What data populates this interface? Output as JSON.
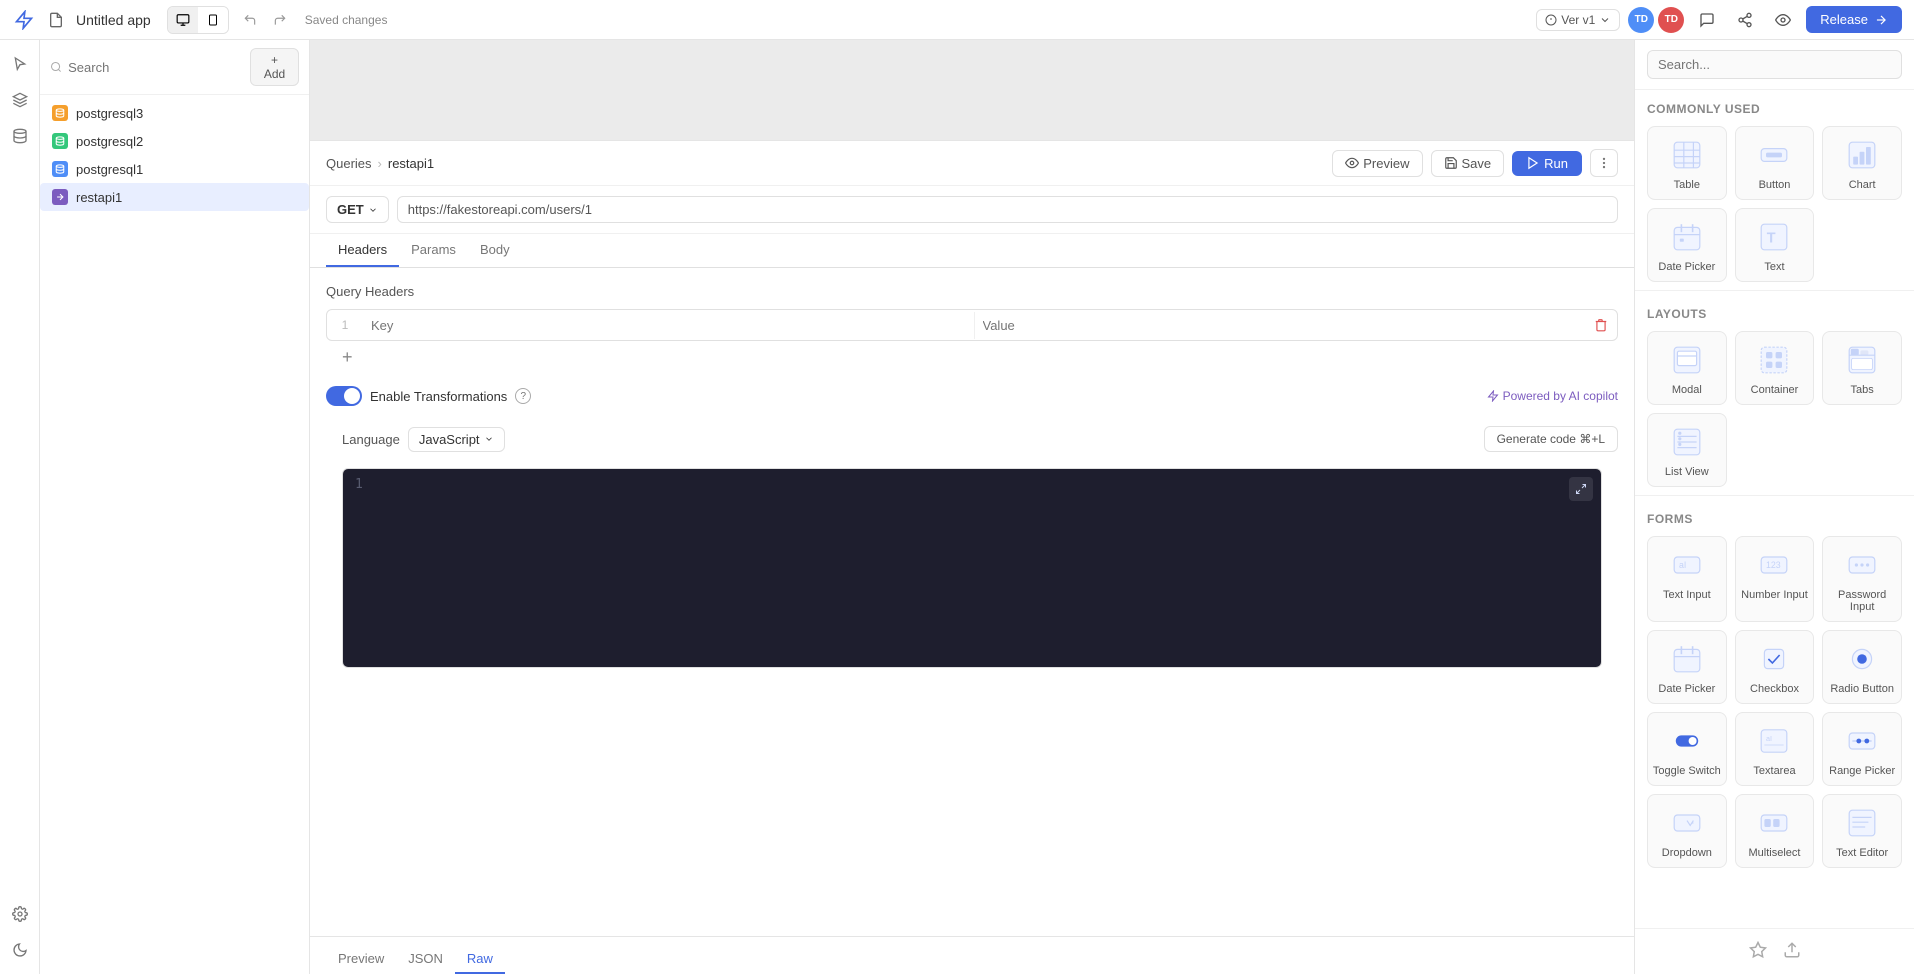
{
  "topbar": {
    "title": "Untitled app",
    "saved_label": "Saved changes",
    "version_label": "Ver  v1",
    "avatar1": "TD",
    "avatar2": "TD",
    "release_label": "Release"
  },
  "left_panel": {
    "search_placeholder": "Search",
    "add_label": "+ Add",
    "items": [
      {
        "id": "postgresql3",
        "label": "postgresql3",
        "type": "db"
      },
      {
        "id": "postgresql2",
        "label": "postgresql2",
        "type": "db"
      },
      {
        "id": "postgresql1",
        "label": "postgresql1",
        "type": "db"
      },
      {
        "id": "restapi1",
        "label": "restapi1",
        "type": "restapi",
        "active": true
      }
    ]
  },
  "query_editor": {
    "breadcrumb_root": "Queries",
    "breadcrumb_current": "restapi1",
    "preview_label": "Preview",
    "save_label": "Save",
    "run_label": "Run",
    "method": "GET",
    "url": "https://fakestoreapi.com/users/1",
    "tabs": [
      "Headers",
      "Params",
      "Body"
    ],
    "active_tab": "Headers",
    "headers_title": "Query Headers",
    "header_key_placeholder": "Key",
    "header_value_placeholder": "Value",
    "enable_transformations_label": "Enable Transformations",
    "ai_copilot_label": "Powered by AI copilot",
    "language_label": "Language",
    "language_value": "JavaScript",
    "generate_code_label": "Generate code ⌘+L",
    "code_line": "1",
    "result_tabs": [
      "Preview",
      "JSON",
      "Raw"
    ],
    "active_result_tab": "Raw"
  },
  "right_panel": {
    "search_placeholder": "Search...",
    "commonly_used_title": "Commonly Used",
    "layouts_title": "Layouts",
    "forms_title": "Forms",
    "components": {
      "commonly_used": [
        {
          "id": "table",
          "label": "Table",
          "icon": "table"
        },
        {
          "id": "button",
          "label": "Button",
          "icon": "button"
        },
        {
          "id": "chart",
          "label": "Chart",
          "icon": "chart"
        },
        {
          "id": "date-picker",
          "label": "Date Picker",
          "icon": "datepicker"
        },
        {
          "id": "text",
          "label": "Text",
          "icon": "text"
        }
      ],
      "layouts": [
        {
          "id": "modal",
          "label": "Modal",
          "icon": "modal"
        },
        {
          "id": "container",
          "label": "Container",
          "icon": "container"
        },
        {
          "id": "tabs",
          "label": "Tabs",
          "icon": "tabs"
        },
        {
          "id": "list-view",
          "label": "List View",
          "icon": "listview"
        }
      ],
      "forms": [
        {
          "id": "text-input",
          "label": "Text Input",
          "icon": "textinput"
        },
        {
          "id": "number-input",
          "label": "Number Input",
          "icon": "numberinput"
        },
        {
          "id": "password-input",
          "label": "Password Input",
          "icon": "passwordinput"
        },
        {
          "id": "date-picker-form",
          "label": "Date Picker",
          "icon": "datepicker2"
        },
        {
          "id": "checkbox",
          "label": "Checkbox",
          "icon": "checkbox"
        },
        {
          "id": "radio-button",
          "label": "Radio Button",
          "icon": "radiobutton"
        },
        {
          "id": "toggle-switch",
          "label": "Toggle Switch",
          "icon": "toggleswitch"
        },
        {
          "id": "textarea",
          "label": "Textarea",
          "icon": "textarea"
        },
        {
          "id": "range-picker",
          "label": "Range Picker",
          "icon": "rangepicker"
        },
        {
          "id": "dropdown",
          "label": "Dropdown",
          "icon": "dropdown"
        },
        {
          "id": "multiselect",
          "label": "Multiselect",
          "icon": "multiselect"
        },
        {
          "id": "text-editor",
          "label": "Text Editor",
          "icon": "texteditor"
        }
      ]
    }
  }
}
